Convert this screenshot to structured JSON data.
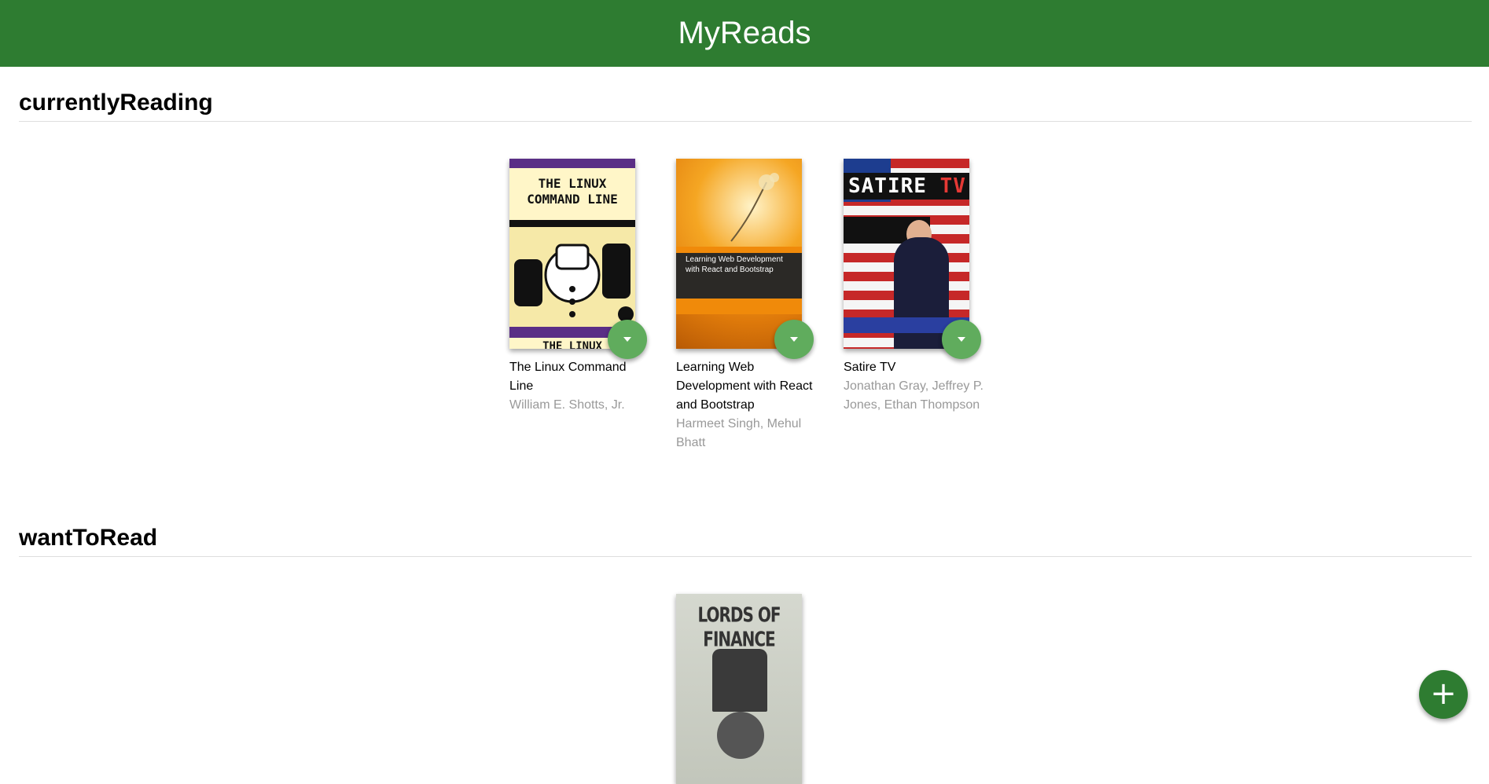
{
  "header": {
    "title": "MyReads"
  },
  "shelves": [
    {
      "title": "currentlyReading",
      "books": [
        {
          "title": "The Linux Command Line",
          "authors": "William E. Shotts, Jr.",
          "cover": {
            "line1": "THE LINUX",
            "line2": "COMMAND LINE",
            "footer": "THE LINUX"
          }
        },
        {
          "title": "Learning Web Development with React and Bootstrap",
          "authors": "Harmeet Singh, Mehul Bhatt",
          "cover": {
            "text": "Learning Web Development with React and Bootstrap"
          }
        },
        {
          "title": "Satire TV",
          "authors": "Jonathan Gray, Jeffrey P. Jones, Ethan Thompson",
          "cover": {
            "word1": "SATIRE",
            "word2": "TV"
          }
        }
      ]
    },
    {
      "title": "wantToRead",
      "books": [
        {
          "title": "",
          "authors": "",
          "cover": {
            "text": "LORDS OF FINANCE"
          }
        }
      ]
    }
  ],
  "fab": {
    "icon": "plus-icon",
    "label": "+"
  },
  "colors": {
    "header": "#2e7c31",
    "shelf_changer": "#60ac5d",
    "author_text": "#999999"
  }
}
